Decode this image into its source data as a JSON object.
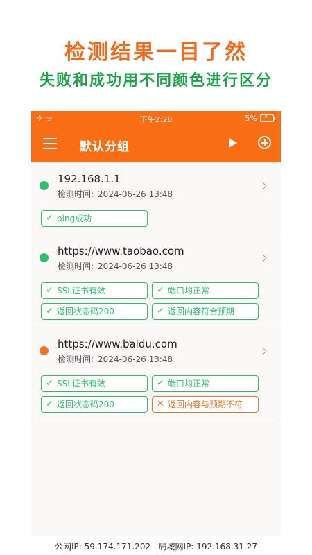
{
  "promo": {
    "title": "检测结果一目了然",
    "subtitle": "失败和成功用不同颜色进行区分"
  },
  "status_bar": {
    "left": "✈ ᯤ",
    "time": "下午2:28",
    "battery": "5%"
  },
  "nav": {
    "title": "默认分组",
    "icons": [
      "menu-icon",
      "play-icon",
      "add-circle-icon"
    ]
  },
  "colors": {
    "accent": "#f96d14",
    "success": "#2fbf6c",
    "fail": "#f0752a"
  },
  "items": [
    {
      "url": "192.168.1.1",
      "time_label": "检测时间:",
      "time": "2024-06-26 13:48",
      "status": "success",
      "tags": [
        {
          "label": "ping成功",
          "ok": true
        }
      ]
    },
    {
      "url": "https://www.taobao.com",
      "time_label": "检测时间:",
      "time": "2024-06-26 13:48",
      "status": "success",
      "tags": [
        {
          "label": "SSL证书有效",
          "ok": true
        },
        {
          "label": "端口均正常",
          "ok": true
        },
        {
          "label": "返回状态码200",
          "ok": true
        },
        {
          "label": "返回内容符合预期",
          "ok": true
        }
      ]
    },
    {
      "url": "https://www.baidu.com",
      "time_label": "检测时间:",
      "time": "2024-06-26 13:48",
      "status": "fail",
      "tags": [
        {
          "label": "SSL证书有效",
          "ok": true
        },
        {
          "label": "端口均正常",
          "ok": true
        },
        {
          "label": "返回状态码200",
          "ok": true
        },
        {
          "label": "返回内容与预期不符",
          "ok": false
        }
      ]
    }
  ],
  "footer": {
    "public_ip_label": "公网IP:",
    "public_ip": "59.174.171.202",
    "lan_ip_label": "局域网IP:",
    "lan_ip": "192.168.31.27"
  }
}
